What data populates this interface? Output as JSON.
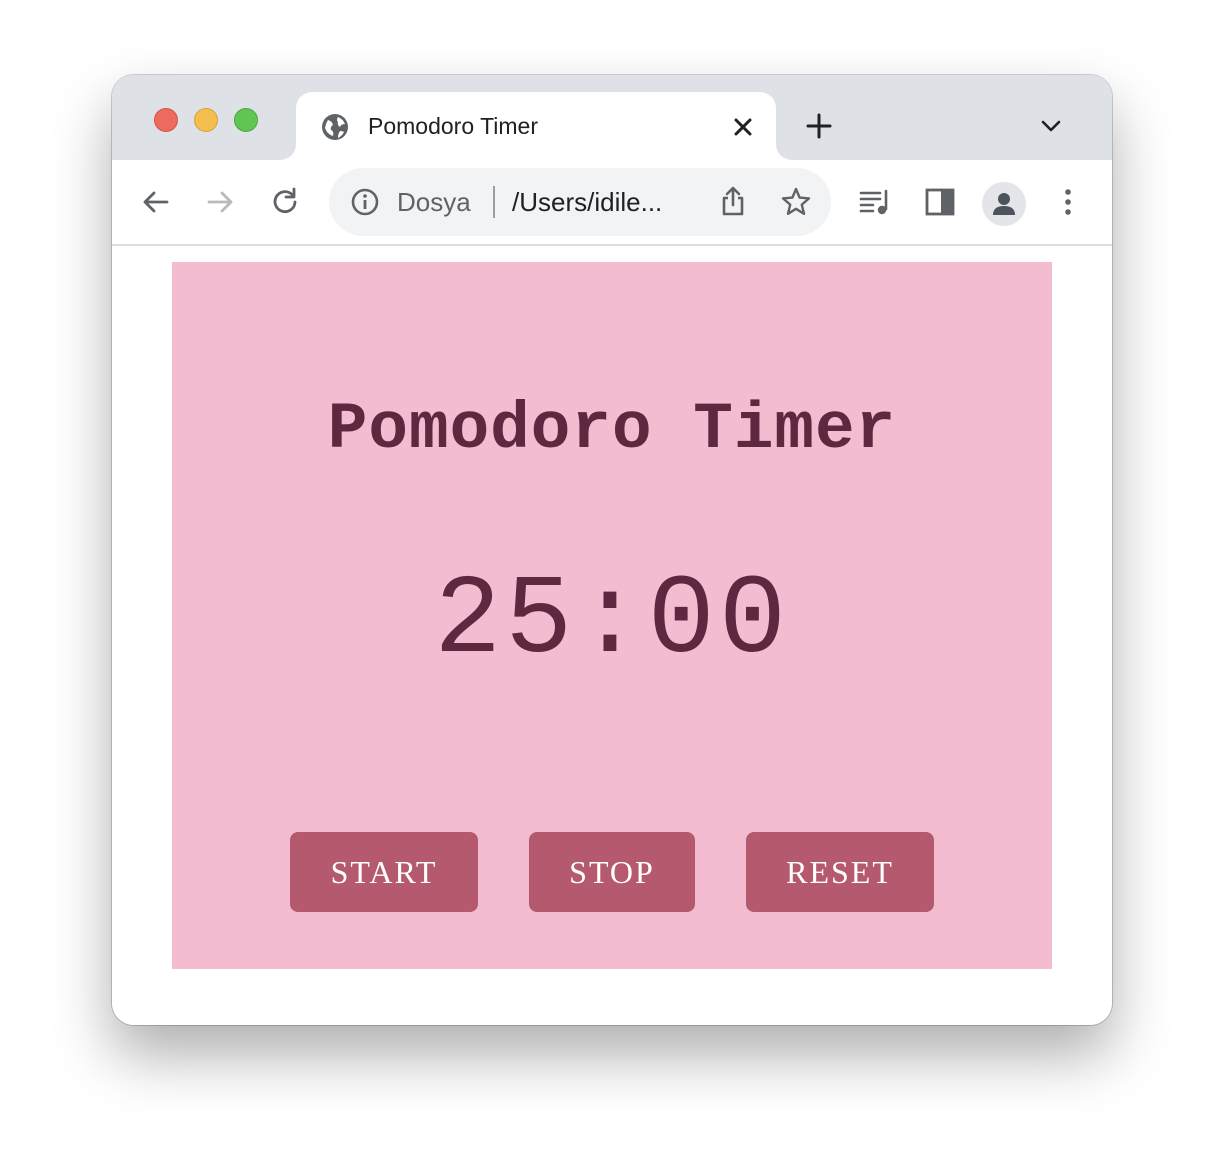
{
  "browser": {
    "tab": {
      "title": "Pomodoro Timer"
    },
    "omnibox": {
      "scheme_label": "Dosya",
      "url": "/Users/idile..."
    },
    "icons": {
      "traffic": [
        "close-dot",
        "minimize-dot",
        "zoom-dot"
      ],
      "tab_favicon": "globe-icon",
      "toolbar": [
        "back-arrow-icon",
        "forward-arrow-icon",
        "reload-icon",
        "info-icon",
        "share-icon",
        "star-icon",
        "media-queue-icon",
        "side-panel-icon",
        "profile-icon",
        "kebab-menu-icon"
      ]
    }
  },
  "app": {
    "title": "Pomodoro Timer",
    "timer": "25:00",
    "buttons": {
      "start": "START",
      "stop": "STOP",
      "reset": "RESET"
    },
    "colors": {
      "background": "#f4bcd0",
      "text": "#5e2840",
      "button": "#b55a6e",
      "button_text": "#ffffff"
    }
  }
}
